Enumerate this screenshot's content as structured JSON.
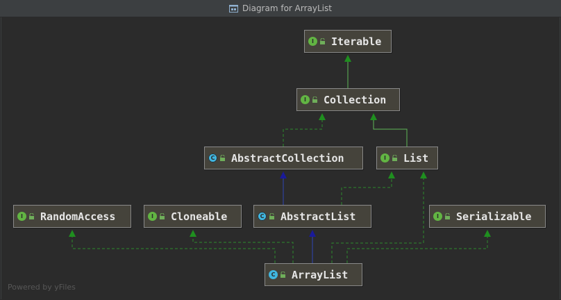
{
  "window": {
    "title": "Diagram for ArrayList"
  },
  "nodes": {
    "iterable": {
      "label": "Iterable",
      "kind": "interface"
    },
    "collection": {
      "label": "Collection",
      "kind": "interface"
    },
    "abstract_collection": {
      "label": "AbstractCollection",
      "kind": "abstract-class"
    },
    "list": {
      "label": "List",
      "kind": "interface"
    },
    "random_access": {
      "label": "RandomAccess",
      "kind": "interface"
    },
    "cloneable": {
      "label": "Cloneable",
      "kind": "interface"
    },
    "abstract_list": {
      "label": "AbstractList",
      "kind": "abstract-class"
    },
    "serializable": {
      "label": "Serializable",
      "kind": "interface"
    },
    "array_list": {
      "label": "ArrayList",
      "kind": "class"
    }
  },
  "kind_glyphs": {
    "interface": "I",
    "class": "C",
    "abstract-class": "C"
  },
  "edges": [
    {
      "from": "collection",
      "to": "iterable",
      "type": "extends"
    },
    {
      "from": "abstract_collection",
      "to": "collection",
      "type": "implements"
    },
    {
      "from": "list",
      "to": "collection",
      "type": "extends"
    },
    {
      "from": "abstract_list",
      "to": "abstract_collection",
      "type": "extends"
    },
    {
      "from": "abstract_list",
      "to": "list",
      "type": "implements"
    },
    {
      "from": "array_list",
      "to": "abstract_list",
      "type": "extends"
    },
    {
      "from": "array_list",
      "to": "list",
      "type": "implements"
    },
    {
      "from": "array_list",
      "to": "random_access",
      "type": "implements"
    },
    {
      "from": "array_list",
      "to": "cloneable",
      "type": "implements"
    },
    {
      "from": "array_list",
      "to": "serializable",
      "type": "implements"
    }
  ],
  "colors": {
    "interface_edge": "#5fb757",
    "extends_class_edge": "#2f45b5",
    "implements_edge": "#2e8b2e"
  },
  "watermark": "Powered by yFiles"
}
